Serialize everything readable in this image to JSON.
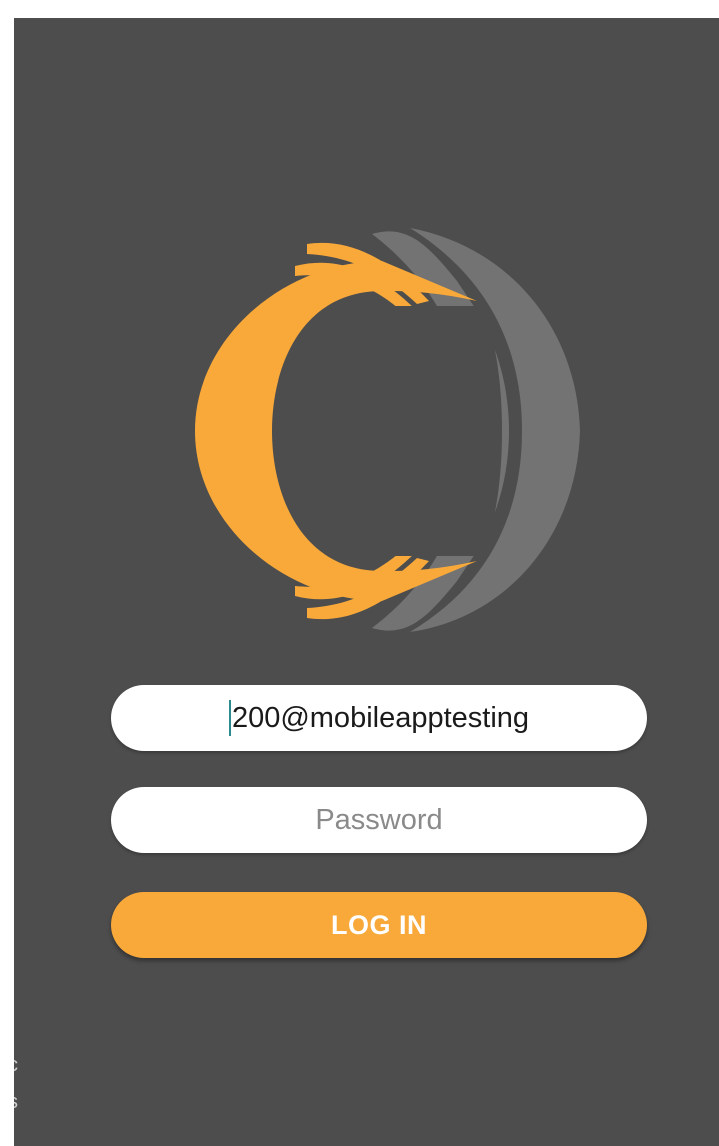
{
  "login": {
    "username_value": "200@mobileapptesting",
    "password_placeholder": "Password",
    "login_label": "LOG IN"
  },
  "edge": {
    "char1": "c",
    "char2": "s"
  },
  "colors": {
    "background": "#4d4d4d",
    "accent": "#f8a93a",
    "logo_gray": "#737373",
    "field_bg": "#ffffff"
  },
  "icons": {
    "logo": "app-logo-icon"
  }
}
